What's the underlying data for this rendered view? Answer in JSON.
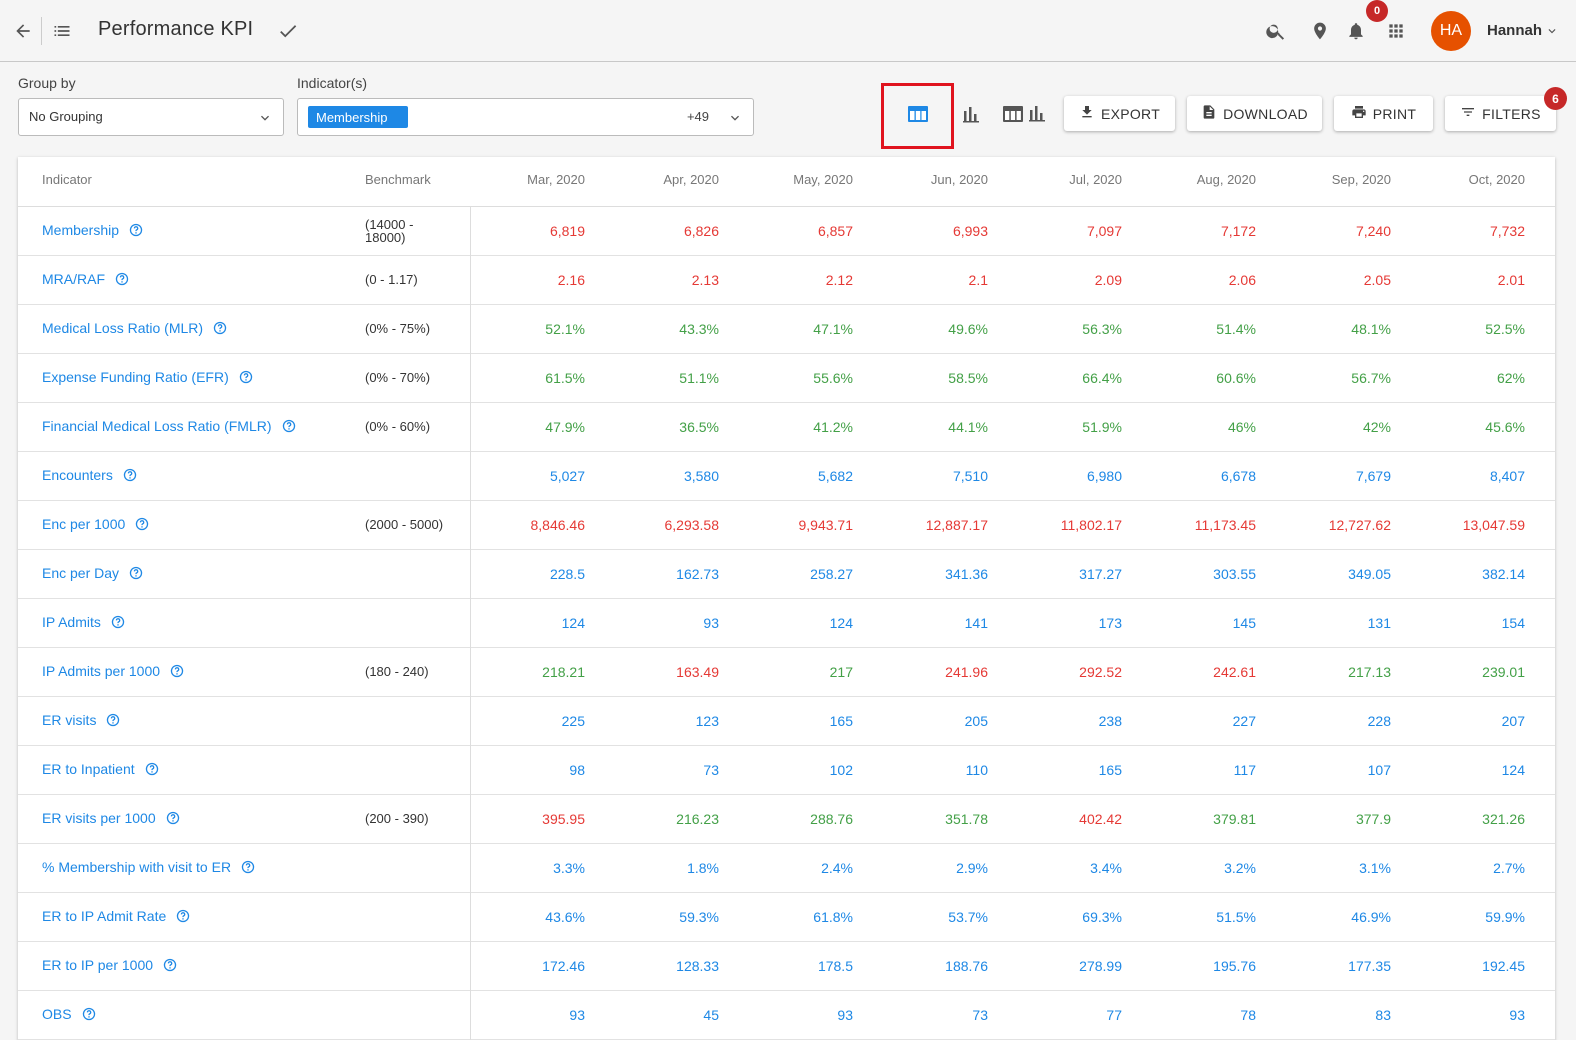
{
  "header": {
    "title": "Performance KPI",
    "notifications_count": "0",
    "user_initials": "HA",
    "user_name": "Hannah"
  },
  "filters": {
    "group_by_label": "Group by",
    "group_by_value": "No Grouping",
    "indicators_label": "Indicator(s)",
    "indicators_chip": "Membership",
    "indicators_more": "+49"
  },
  "toolbar": {
    "export_label": "EXPORT",
    "download_label": "DOWNLOAD",
    "print_label": "PRINT",
    "filters_label": "FILTERS",
    "filters_count": "6"
  },
  "colors": {
    "accent": "#1e88e5",
    "red": "#e53935",
    "green": "#43a047",
    "badge": "#c62828",
    "avatar": "#e65100"
  },
  "table": {
    "columns": [
      "Indicator",
      "Benchmark",
      "Mar, 2020",
      "Apr, 2020",
      "May, 2020",
      "Jun, 2020",
      "Jul, 2020",
      "Aug, 2020",
      "Sep, 2020",
      "Oct, 2020"
    ],
    "rows": [
      {
        "indicator": "Membership",
        "benchmark": "(14000 - 18000)",
        "values": [
          "6,819",
          "6,826",
          "6,857",
          "6,993",
          "7,097",
          "7,172",
          "7,240",
          "7,732"
        ],
        "colors": [
          "red",
          "red",
          "red",
          "red",
          "red",
          "red",
          "red",
          "red"
        ]
      },
      {
        "indicator": "MRA/RAF",
        "benchmark": "(0 - 1.17)",
        "values": [
          "2.16",
          "2.13",
          "2.12",
          "2.1",
          "2.09",
          "2.06",
          "2.05",
          "2.01"
        ],
        "colors": [
          "red",
          "red",
          "red",
          "red",
          "red",
          "red",
          "red",
          "red"
        ]
      },
      {
        "indicator": "Medical Loss Ratio (MLR)",
        "benchmark": "(0% - 75%)",
        "values": [
          "52.1%",
          "43.3%",
          "47.1%",
          "49.6%",
          "56.3%",
          "51.4%",
          "48.1%",
          "52.5%"
        ],
        "colors": [
          "green",
          "green",
          "green",
          "green",
          "green",
          "green",
          "green",
          "green"
        ]
      },
      {
        "indicator": "Expense Funding Ratio (EFR)",
        "benchmark": "(0% - 70%)",
        "values": [
          "61.5%",
          "51.1%",
          "55.6%",
          "58.5%",
          "66.4%",
          "60.6%",
          "56.7%",
          "62%"
        ],
        "colors": [
          "green",
          "green",
          "green",
          "green",
          "green",
          "green",
          "green",
          "green"
        ]
      },
      {
        "indicator": "Financial Medical Loss Ratio (FMLR)",
        "benchmark": "(0% - 60%)",
        "values": [
          "47.9%",
          "36.5%",
          "41.2%",
          "44.1%",
          "51.9%",
          "46%",
          "42%",
          "45.6%"
        ],
        "colors": [
          "green",
          "green",
          "green",
          "green",
          "green",
          "green",
          "green",
          "green"
        ]
      },
      {
        "indicator": "Encounters",
        "benchmark": "",
        "values": [
          "5,027",
          "3,580",
          "5,682",
          "7,510",
          "6,980",
          "6,678",
          "7,679",
          "8,407"
        ],
        "colors": [
          "blue",
          "blue",
          "blue",
          "blue",
          "blue",
          "blue",
          "blue",
          "blue"
        ]
      },
      {
        "indicator": "Enc per 1000",
        "benchmark": "(2000 - 5000)",
        "values": [
          "8,846.46",
          "6,293.58",
          "9,943.71",
          "12,887.17",
          "11,802.17",
          "11,173.45",
          "12,727.62",
          "13,047.59"
        ],
        "colors": [
          "red",
          "red",
          "red",
          "red",
          "red",
          "red",
          "red",
          "red"
        ]
      },
      {
        "indicator": "Enc per Day",
        "benchmark": "",
        "values": [
          "228.5",
          "162.73",
          "258.27",
          "341.36",
          "317.27",
          "303.55",
          "349.05",
          "382.14"
        ],
        "colors": [
          "blue",
          "blue",
          "blue",
          "blue",
          "blue",
          "blue",
          "blue",
          "blue"
        ]
      },
      {
        "indicator": "IP Admits",
        "benchmark": "",
        "values": [
          "124",
          "93",
          "124",
          "141",
          "173",
          "145",
          "131",
          "154"
        ],
        "colors": [
          "blue",
          "blue",
          "blue",
          "blue",
          "blue",
          "blue",
          "blue",
          "blue"
        ]
      },
      {
        "indicator": "IP Admits per 1000",
        "benchmark": "(180 - 240)",
        "values": [
          "218.21",
          "163.49",
          "217",
          "241.96",
          "292.52",
          "242.61",
          "217.13",
          "239.01"
        ],
        "colors": [
          "green",
          "red",
          "green",
          "red",
          "red",
          "red",
          "green",
          "green"
        ]
      },
      {
        "indicator": "ER visits",
        "benchmark": "",
        "values": [
          "225",
          "123",
          "165",
          "205",
          "238",
          "227",
          "228",
          "207"
        ],
        "colors": [
          "blue",
          "blue",
          "blue",
          "blue",
          "blue",
          "blue",
          "blue",
          "blue"
        ]
      },
      {
        "indicator": "ER to Inpatient",
        "benchmark": "",
        "values": [
          "98",
          "73",
          "102",
          "110",
          "165",
          "117",
          "107",
          "124"
        ],
        "colors": [
          "blue",
          "blue",
          "blue",
          "blue",
          "blue",
          "blue",
          "blue",
          "blue"
        ]
      },
      {
        "indicator": "ER visits per 1000",
        "benchmark": "(200 - 390)",
        "values": [
          "395.95",
          "216.23",
          "288.76",
          "351.78",
          "402.42",
          "379.81",
          "377.9",
          "321.26"
        ],
        "colors": [
          "red",
          "green",
          "green",
          "green",
          "red",
          "green",
          "green",
          "green"
        ]
      },
      {
        "indicator": "% Membership with visit to ER",
        "benchmark": "",
        "values": [
          "3.3%",
          "1.8%",
          "2.4%",
          "2.9%",
          "3.4%",
          "3.2%",
          "3.1%",
          "2.7%"
        ],
        "colors": [
          "blue",
          "blue",
          "blue",
          "blue",
          "blue",
          "blue",
          "blue",
          "blue"
        ]
      },
      {
        "indicator": "ER to IP Admit Rate",
        "benchmark": "",
        "values": [
          "43.6%",
          "59.3%",
          "61.8%",
          "53.7%",
          "69.3%",
          "51.5%",
          "46.9%",
          "59.9%"
        ],
        "colors": [
          "blue",
          "blue",
          "blue",
          "blue",
          "blue",
          "blue",
          "blue",
          "blue"
        ]
      },
      {
        "indicator": "ER to IP per 1000",
        "benchmark": "",
        "values": [
          "172.46",
          "128.33",
          "178.5",
          "188.76",
          "278.99",
          "195.76",
          "177.35",
          "192.45"
        ],
        "colors": [
          "blue",
          "blue",
          "blue",
          "blue",
          "blue",
          "blue",
          "blue",
          "blue"
        ]
      },
      {
        "indicator": "OBS",
        "benchmark": "",
        "values": [
          "93",
          "45",
          "93",
          "73",
          "77",
          "78",
          "83",
          "93"
        ],
        "colors": [
          "blue",
          "blue",
          "blue",
          "blue",
          "blue",
          "blue",
          "blue",
          "blue"
        ]
      }
    ]
  }
}
